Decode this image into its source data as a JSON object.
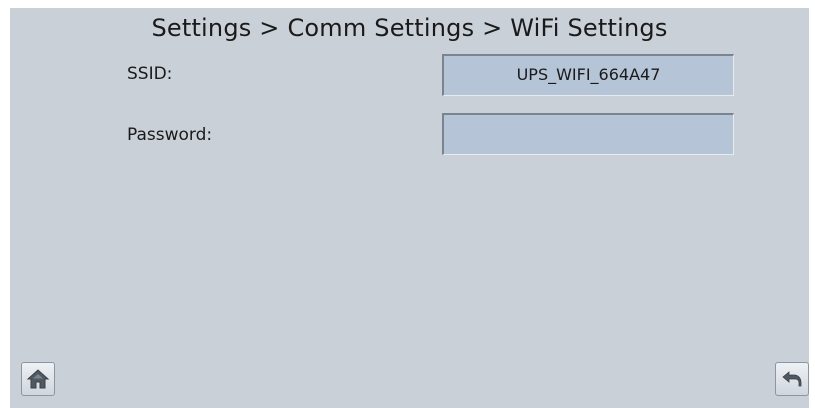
{
  "header": {
    "breadcrumb": "Settings > Comm Settings > WiFi Settings"
  },
  "form": {
    "ssid": {
      "label": "SSID:",
      "value": "UPS_WIFI_664A47"
    },
    "password": {
      "label": "Password:",
      "value": ""
    }
  },
  "footer": {
    "home_icon": "home-icon",
    "back_icon": "back-arrow-icon"
  },
  "colors": {
    "background": "#c9d0d8",
    "field": "#b5c4d6"
  }
}
